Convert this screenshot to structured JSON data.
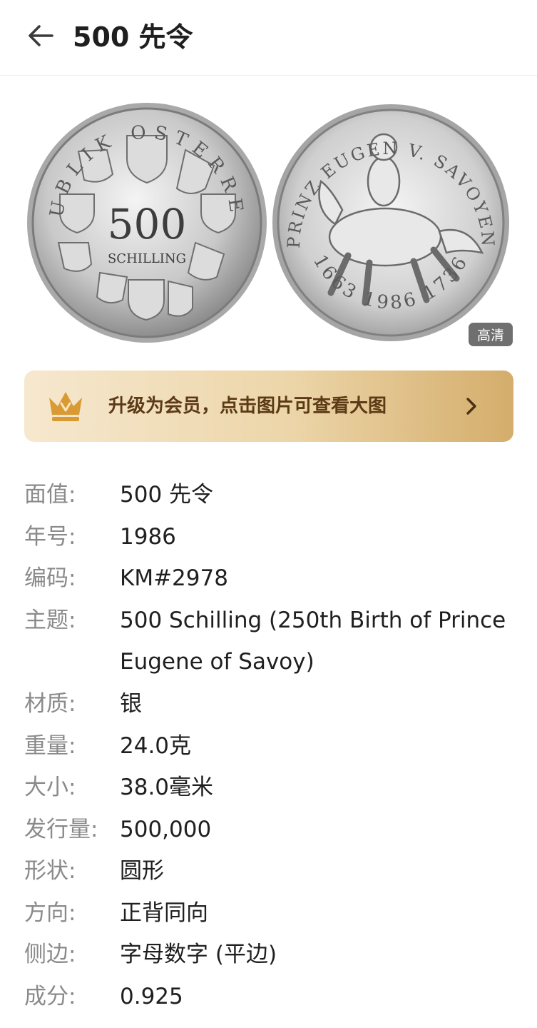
{
  "header": {
    "title": "500 先令"
  },
  "coin": {
    "obverse_legend": "REPUBLIK OSTERREICH",
    "obverse_value": "500",
    "obverse_unit": "SCHILLING",
    "reverse_legend": "PRINZ EUGEN V. SAVOYEN",
    "reverse_years": "1663 1986 1736",
    "hd_label": "高清"
  },
  "banner": {
    "text": "升级为会员，点击图片可查看大图",
    "icon": "crown-icon"
  },
  "details": [
    {
      "label": "面值:",
      "value": "500 先令"
    },
    {
      "label": "年号:",
      "value": "1986"
    },
    {
      "label": "编码:",
      "value": "KM#2978"
    },
    {
      "label": "主题:",
      "value": "500 Schilling (250th Birth of Prince Eugene of Savoy)"
    },
    {
      "label": "材质:",
      "value": "银"
    },
    {
      "label": "重量:",
      "value": "24.0克"
    },
    {
      "label": "大小:",
      "value": "38.0毫米"
    },
    {
      "label": "发行量:",
      "value": "500,000"
    },
    {
      "label": "形状:",
      "value": "圆形"
    },
    {
      "label": "方向:",
      "value": "正背同向"
    },
    {
      "label": "侧边:",
      "value": "字母数字 (平边)"
    },
    {
      "label": "成分:",
      "value": "0.925"
    }
  ],
  "colors": {
    "banner_text": "#5c3a17",
    "label": "#8a8a8a",
    "value": "#1f1f1f"
  }
}
